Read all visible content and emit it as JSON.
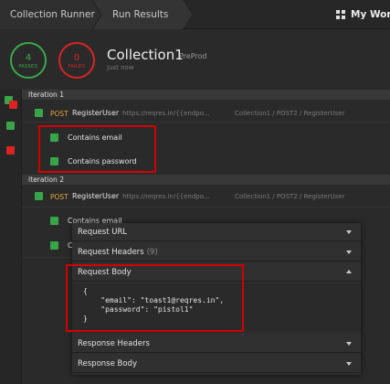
{
  "breadcrumb": {
    "item1": "Collection Runner",
    "item2": "Run Results"
  },
  "workspace": {
    "label": "My Works",
    "icon": "grid-icon"
  },
  "summary": {
    "passed_count": "4",
    "passed_label": "PASSED",
    "failed_count": "0",
    "failed_label": "FAILED",
    "collection_name": "Collection1",
    "environment": "PreProd",
    "time": "Just now"
  },
  "colors": {
    "pass": "#3aa94a",
    "fail": "#dd2222",
    "method_post": "#e8a23a",
    "highlight": "#d40000"
  },
  "iterations": [
    {
      "label": "Iteration 1",
      "request": {
        "method": "POST",
        "name": "RegisterUser",
        "url": "https://reqres.in/{{endpo...",
        "path": "Collection1 / POST2 / RegisterUser"
      },
      "tests": [
        "Contains email",
        "Contains password"
      ]
    },
    {
      "label": "Iteration 2",
      "request": {
        "method": "POST",
        "name": "RegisterUser",
        "url": "https://reqres.in/{{endpo...",
        "path": "Collection1 / POST2 / RegisterUser"
      },
      "tests": [
        "Contains email",
        "C"
      ]
    }
  ],
  "details_panel": {
    "request_url": "Request URL",
    "request_headers": "Request Headers",
    "request_headers_count": "(9)",
    "request_body": "Request Body",
    "request_body_json": "{\n    \"email\": \"toast1@reqres.in\",\n    \"password\": \"pistol1\"\n}",
    "response_headers": "Response Headers",
    "response_body": "Response Body"
  }
}
